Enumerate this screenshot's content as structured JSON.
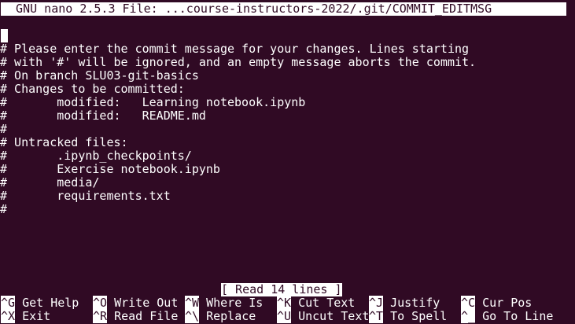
{
  "title_bar": "  GNU nano 2.5.3 File: ...course-instructors-2022/.git/COMMIT_EDITMSG",
  "lines": [
    "",
    "# Please enter the commit message for your changes. Lines starting",
    "# with '#' will be ignored, and an empty message aborts the commit.",
    "# On branch SLU03-git-basics",
    "# Changes to be committed:",
    "#       modified:   Learning notebook.ipynb",
    "#       modified:   README.md",
    "#",
    "# Untracked files:",
    "#       .ipynb_checkpoints/",
    "#       Exercise notebook.ipynb",
    "#       media/",
    "#       requirements.txt",
    "#"
  ],
  "status_message": "[ Read 14 lines ]",
  "shortcuts": {
    "row1": [
      {
        "key": "^G",
        "label": " Get Help"
      },
      {
        "key": "^O",
        "label": " Write Out"
      },
      {
        "key": "^W",
        "label": " Where Is"
      },
      {
        "key": "^K",
        "label": " Cut Text"
      },
      {
        "key": "^J",
        "label": " Justify"
      },
      {
        "key": "^C",
        "label": " Cur Pos"
      }
    ],
    "row2": [
      {
        "key": "^X",
        "label": " Exit"
      },
      {
        "key": "^R",
        "label": " Read File"
      },
      {
        "key": "^\\",
        "label": " Replace"
      },
      {
        "key": "^U",
        "label": " Uncut Text"
      },
      {
        "key": "^T",
        "label": " To Spell"
      },
      {
        "key": "^_",
        "label": " Go To Line"
      }
    ]
  }
}
